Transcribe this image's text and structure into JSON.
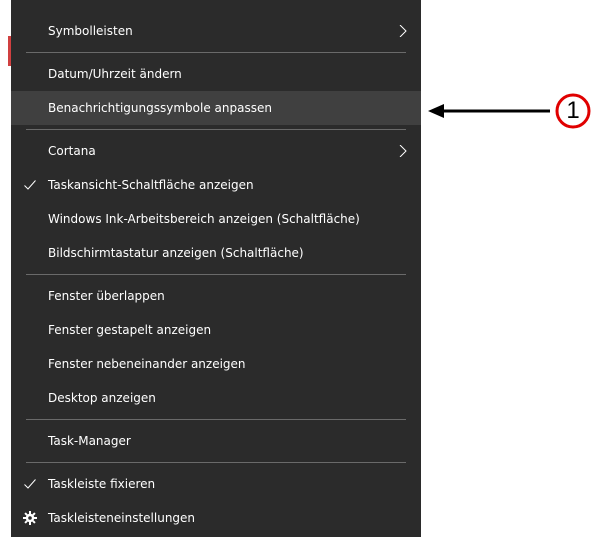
{
  "menu": {
    "items": [
      {
        "label": "Symbolleisten",
        "has_submenu": true,
        "checked": false
      },
      {
        "label": "Datum/Uhrzeit ändern",
        "has_submenu": false,
        "checked": false
      },
      {
        "label": "Benachrichtigungssymbole anpassen",
        "has_submenu": false,
        "checked": false,
        "highlighted": true
      },
      {
        "label": "Cortana",
        "has_submenu": true,
        "checked": false
      },
      {
        "label": "Taskansicht-Schaltfläche anzeigen",
        "has_submenu": false,
        "checked": true
      },
      {
        "label": "Windows Ink-Arbeitsbereich anzeigen (Schaltfläche)",
        "has_submenu": false,
        "checked": false
      },
      {
        "label": "Bildschirmtastatur anzeigen (Schaltfläche)",
        "has_submenu": false,
        "checked": false
      },
      {
        "label": "Fenster überlappen",
        "has_submenu": false,
        "checked": false
      },
      {
        "label": "Fenster gestapelt anzeigen",
        "has_submenu": false,
        "checked": false
      },
      {
        "label": "Fenster nebeneinander anzeigen",
        "has_submenu": false,
        "checked": false
      },
      {
        "label": "Desktop anzeigen",
        "has_submenu": false,
        "checked": false
      },
      {
        "label": "Task-Manager",
        "has_submenu": false,
        "checked": false
      },
      {
        "label": "Taskleiste fixieren",
        "has_submenu": false,
        "checked": true
      },
      {
        "label": "Taskleisteneinstellungen",
        "has_submenu": false,
        "checked": false,
        "icon": "gear-icon"
      }
    ]
  },
  "annotation": {
    "callout_number": "1",
    "arrow_icon": "left-arrow-icon"
  },
  "colors": {
    "menu_bg": "#2b2b2b",
    "highlight_bg": "#404040",
    "separator": "#6a6a6a",
    "text": "#ffffff",
    "callout_ring": "#e00000"
  }
}
